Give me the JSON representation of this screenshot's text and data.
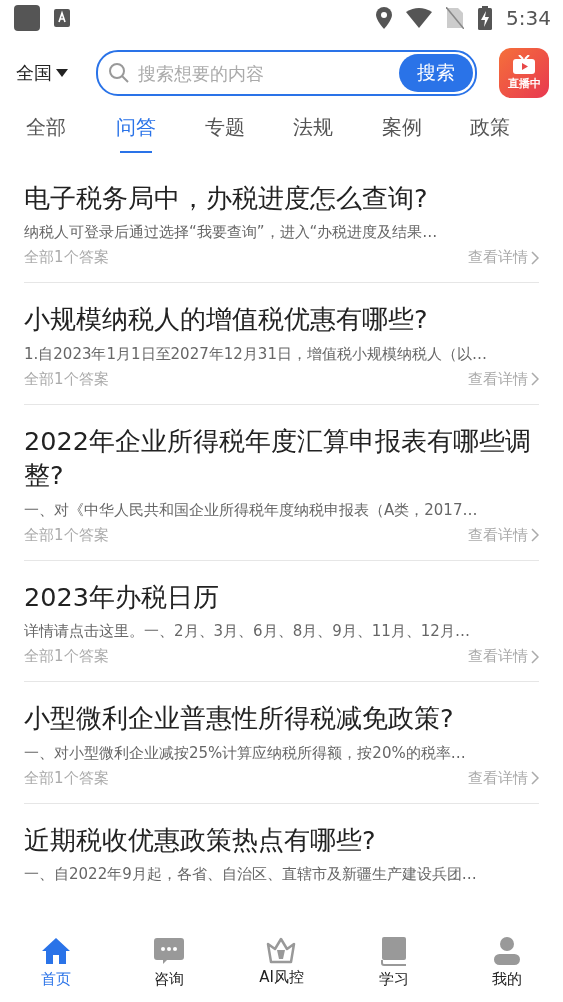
{
  "status_bar": {
    "time": "5:34"
  },
  "header": {
    "location": "全国",
    "search": {
      "placeholder": "搜索想要的内容",
      "button": "搜索"
    },
    "live_badge": "直播中"
  },
  "tabs": [
    {
      "label": "全部",
      "selected": false
    },
    {
      "label": "问答",
      "selected": true
    },
    {
      "label": "专题",
      "selected": false
    },
    {
      "label": "法规",
      "selected": false
    },
    {
      "label": "案例",
      "selected": false
    },
    {
      "label": "政策",
      "selected": false
    }
  ],
  "questions": [
    {
      "title": "电子税务局中，办税进度怎么查询?",
      "summary": "纳税人可登录后通过选择“我要查询”，进入“办税进度及结果…",
      "answers": "全部1个答案",
      "link": "查看详情"
    },
    {
      "title": "小规模纳税人的增值税优惠有哪些?",
      "summary": "1.自2023年1月1日至2027年12月31日，增值税小规模纳税人（以…",
      "answers": "全部1个答案",
      "link": "查看详情"
    },
    {
      "title": "2022年企业所得税年度汇算申报表有哪些调整?",
      "summary": "一、对《中华人民共和国企业所得税年度纳税申报表（A类，2017…",
      "answers": "全部1个答案",
      "link": "查看详情"
    },
    {
      "title": "2023年办税日历",
      "summary": "详情请点击这里。一、2月、3月、6月、8月、9月、11月、12月…",
      "answers": "全部1个答案",
      "link": "查看详情"
    },
    {
      "title": "小型微利企业普惠性所得税减免政策?",
      "summary": "一、对小型微利企业减按25%计算应纳税所得额，按20%的税率…",
      "answers": "全部1个答案",
      "link": "查看详情"
    },
    {
      "title": "近期税收优惠政策热点有哪些?",
      "summary": "一、自2022年9月起，各省、自治区、直辖市及新疆生产建设兵团…"
    }
  ],
  "bottom_nav": [
    {
      "label": "首页",
      "kind": "home",
      "selected": true
    },
    {
      "label": "咨询",
      "kind": "chat",
      "selected": false
    },
    {
      "label": "AI风控",
      "kind": "crown",
      "selected": false
    },
    {
      "label": "学习",
      "kind": "book",
      "selected": false
    },
    {
      "label": "我的",
      "kind": "person",
      "selected": false
    }
  ]
}
